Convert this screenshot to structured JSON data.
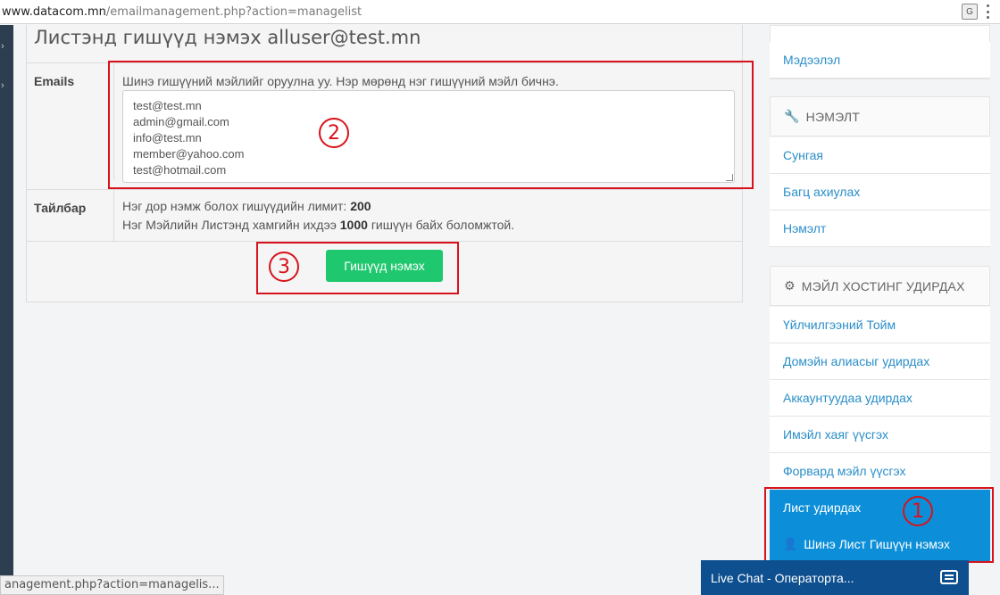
{
  "browser": {
    "url_host": "www.datacom.mn",
    "url_path": "/emailmanagement.php?action=managelist",
    "translate_icon": "translate-icon",
    "status_url": "anagement.php?action=managelis..."
  },
  "main": {
    "title": "Листэнд гишүүд нэмэх alluser@test.mn",
    "emails_label": "Emails",
    "emails_hint": "Шинэ гишүүний мэйлийг оруулна уу. Нэр мөрөнд нэг гишүүний мэйл бичнэ.",
    "emails": [
      "test@test.mn",
      "admin@gmail.com",
      "info@test.mn",
      "member@yahoo.com",
      "test@hotmail.com"
    ],
    "note_label": "Тайлбар",
    "note_line1_text": "Нэг дор нэмж болох гишүүдийн лимит:",
    "note_line1_value": "200",
    "note_line2_prefix": "Нэг Мэйлийн Листэнд хамгийн ихдээ",
    "note_line2_value": "1000",
    "note_line2_suffix": "гишүүн байх боломжтой.",
    "add_button": "Гишүүд нэмэх"
  },
  "annotations": [
    "1",
    "2",
    "3"
  ],
  "sidebar": {
    "info_item": "Мэдээлэл",
    "addon_header": "НЭМЭЛТ",
    "addon_items": [
      "Сунгая",
      "Багц ахиулах",
      "Нэмэлт"
    ],
    "mail_header": "МЭЙЛ ХОСТИНГ УДИРДАХ",
    "mail_items": [
      "Үйлчилгээний Тойм",
      "Домэйн алиасыг удирдах",
      "Аккаунтуудаа удирдах",
      "Имэйл хаяг үүсгэх",
      "Форвард мэйл үүсгэх"
    ],
    "active_item": "Лист удирдах",
    "sub_item": "Шинэ Лист Гишүүн нэмэх"
  },
  "livechat": {
    "label": "Live Chat - Оператортa..."
  },
  "colors": {
    "accent_green": "#1fc86f",
    "active_blue": "#0c8fd8",
    "link_blue": "#2a8ec8",
    "annotation_red": "#d8121b",
    "livechat_navy": "#0d4f8f"
  }
}
